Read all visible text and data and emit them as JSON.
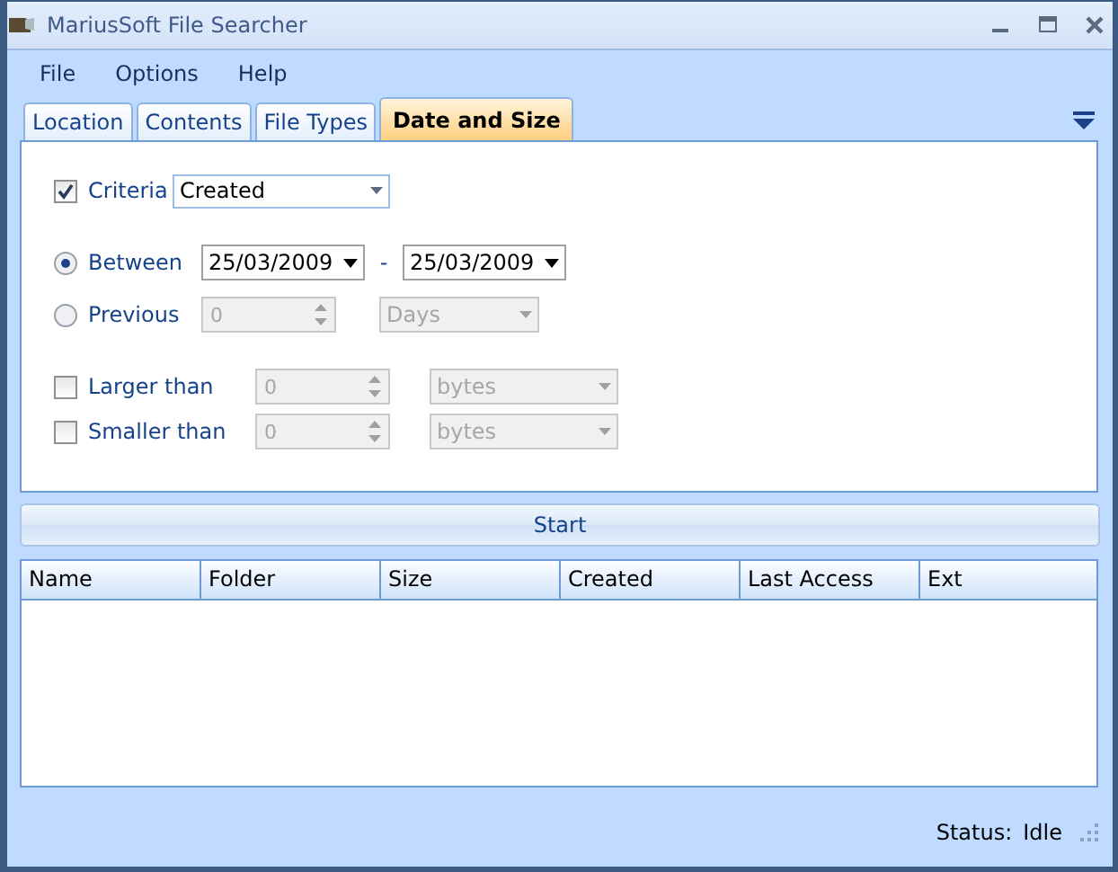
{
  "window": {
    "title": "MariusSoft File Searcher"
  },
  "menu": [
    "File",
    "Options",
    "Help"
  ],
  "tabs": [
    {
      "label": "Location",
      "selected": false
    },
    {
      "label": "Contents",
      "selected": false
    },
    {
      "label": "File Types",
      "selected": false
    },
    {
      "label": "Date and Size",
      "selected": true
    }
  ],
  "criteria": {
    "label": "Criteria",
    "checked": true,
    "value": "Created"
  },
  "range": [
    {
      "kind": "dates",
      "label": "Between",
      "selected": true,
      "from": "25/03/2009",
      "separator": "-",
      "to": "25/03/2009"
    },
    {
      "kind": "count",
      "label": "Previous",
      "selected": false,
      "value": "0",
      "unit": "Days",
      "disabled": true
    }
  ],
  "size_filters": [
    {
      "label": "Larger than",
      "checked": false,
      "value": "0",
      "unit": "bytes",
      "disabled": true
    },
    {
      "label": "Smaller than",
      "checked": false,
      "value": "0",
      "unit": "bytes",
      "disabled": true
    }
  ],
  "start_button": "Start",
  "table": {
    "columns": [
      "Name",
      "Folder",
      "Size",
      "Created",
      "Last Access",
      "Ext"
    ]
  },
  "status_bar": {
    "label": "Status:",
    "value": "Idle"
  }
}
